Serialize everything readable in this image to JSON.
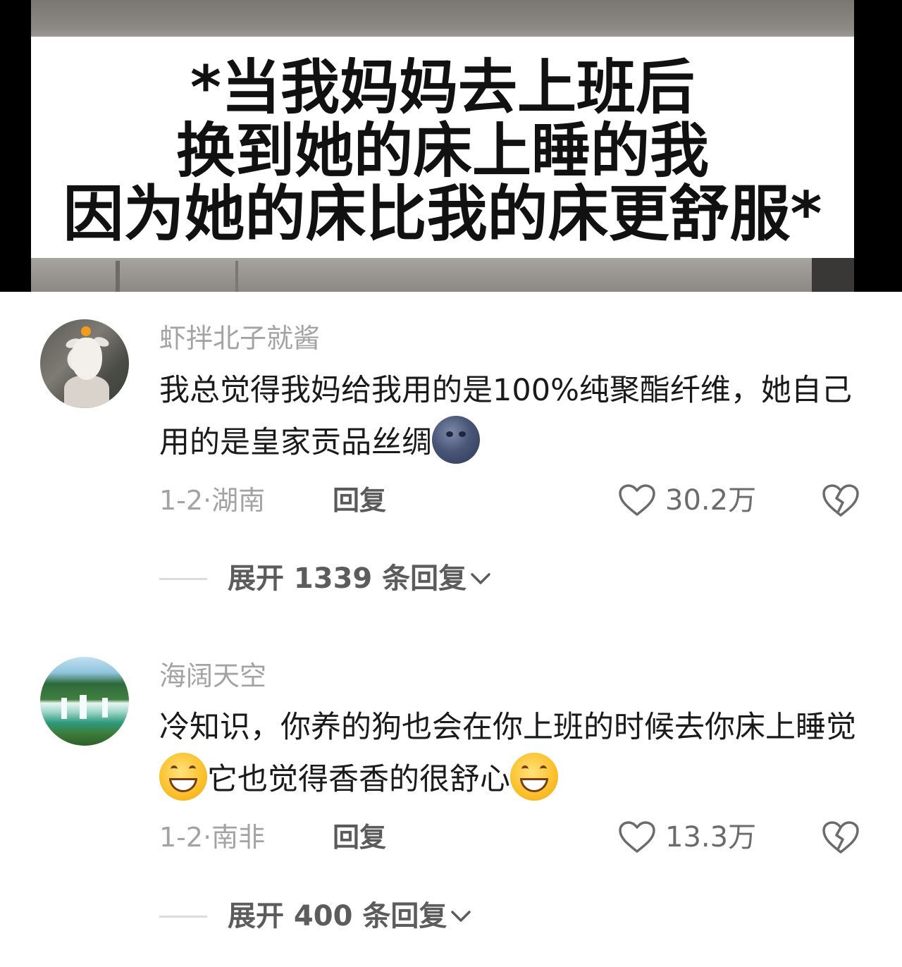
{
  "video": {
    "caption_lines": [
      "*当我妈妈去上班后",
      "换到她的床上睡的我",
      "因为她的床比我的床更舒服*"
    ]
  },
  "comments": [
    {
      "avatar_icon": "goat-avatar",
      "username": "虾拌北子就酱",
      "text_part1": "我总觉得我妈给我用的是100%纯聚酯纤维，她自己用的是皇家贡品丝绸",
      "emoji1": "new-moon-face-emoji",
      "meta": "1-2·湖南",
      "reply_label": "回复",
      "like_count": "30.2万",
      "expand_label": "展开 1339 条回复"
    },
    {
      "avatar_icon": "waterfall-scenery-avatar",
      "username": "海阔天空",
      "text_part1": "冷知识，你养的狗也会在你上班的时候去你床上睡觉",
      "emoji1": "grinning-face-emoji",
      "text_part2": "它也觉得香香的很舒心",
      "emoji2": "grinning-face-emoji",
      "meta": "1-2·南非",
      "reply_label": "回复",
      "like_count": "13.3万",
      "expand_label": "展开 400 条回复"
    }
  ],
  "colors": {
    "username": "#a3a3a3",
    "text": "#1a1a1a",
    "meta": "#a3a3a3",
    "icon": "#6b6b6b"
  }
}
